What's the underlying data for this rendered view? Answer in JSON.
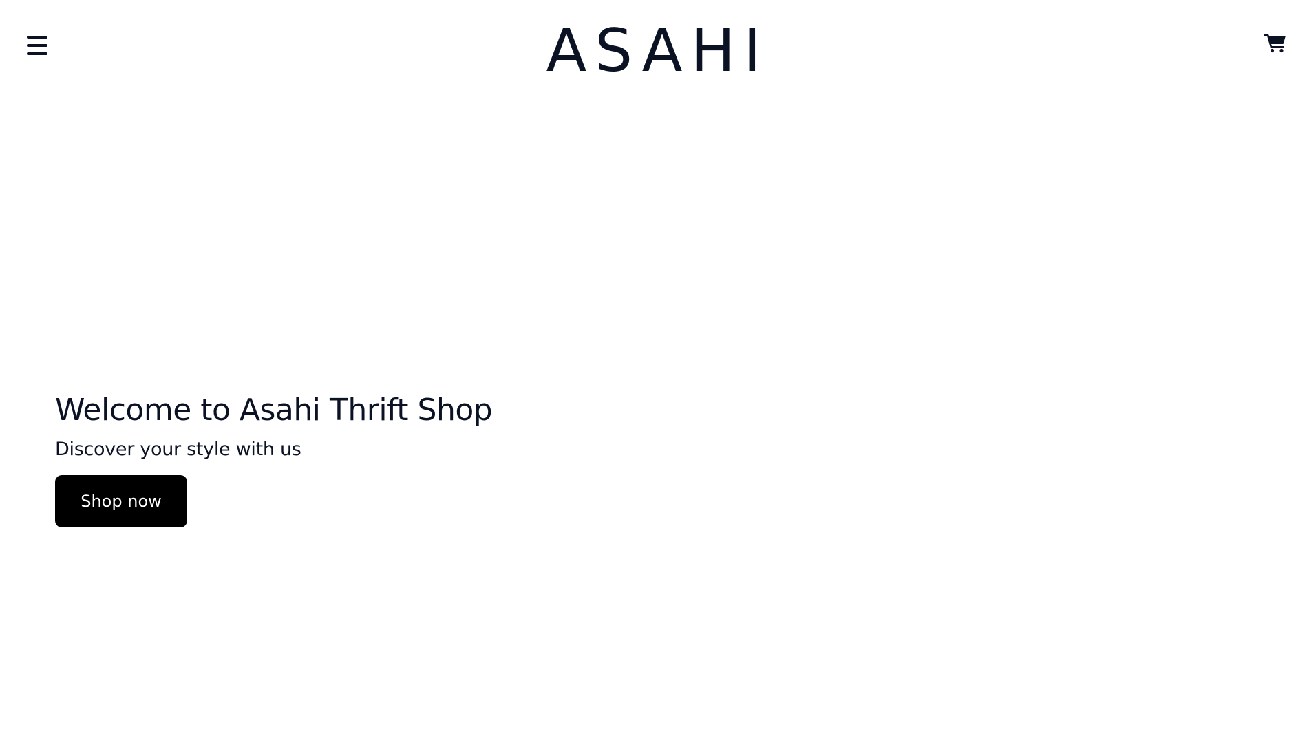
{
  "header": {
    "brand": "ASAHI",
    "menu_icon": "hamburger-menu-icon",
    "cart_icon": "shopping-cart-icon"
  },
  "hero": {
    "title": "Welcome to Asahi Thrift Shop",
    "subtitle": "Discover your style with us",
    "cta_label": "Shop now"
  },
  "colors": {
    "text": "#0b1224",
    "button_bg": "#000000",
    "button_text": "#ffffff",
    "background": "#ffffff"
  }
}
